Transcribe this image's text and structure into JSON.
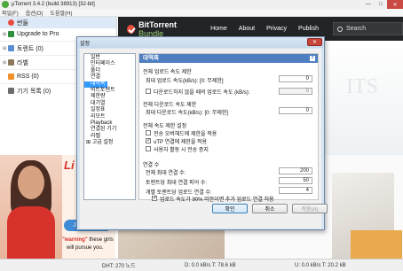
{
  "window": {
    "title": "µTorrent 3.4.2  (build 38913) [32-bit]",
    "controls": [
      "—",
      "□",
      "✕"
    ]
  },
  "menu": [
    "파일(F)",
    "옵션(O)",
    "도움말(H)"
  ],
  "sidebar": {
    "items": [
      {
        "label": "번들",
        "icon": "bundle-icon"
      },
      {
        "label": "Upgrade to Pro",
        "icon": "upgrade-icon"
      },
      {
        "label": "토렌트 (0)",
        "icon": "torrent-icon"
      },
      {
        "label": "라벨",
        "icon": "label-icon"
      },
      {
        "label": "RSS (0)",
        "icon": "rss-icon"
      },
      {
        "label": "기기 목록 (0)",
        "icon": "device-icon"
      }
    ]
  },
  "banner": {
    "brand": "BitTorrent",
    "brand_suffix": " Bundle",
    "nav": [
      "Home",
      "About",
      "Privacy",
      "Publish"
    ],
    "search_placeholder": "Search"
  },
  "ghost_text": "ITS",
  "ad_left": {
    "logo": "Li",
    "button": "Join NOW!",
    "line1_red": "\"warning\"",
    "line1_rest": " these girls",
    "line2": "will pursue you."
  },
  "dialog": {
    "title": "설정",
    "close": "✕",
    "tree": [
      {
        "label": "일반",
        "level": "child"
      },
      {
        "label": "인터페이스",
        "level": "child"
      },
      {
        "label": "폴더",
        "level": "child"
      },
      {
        "label": "연결",
        "level": "child"
      },
      {
        "label": "대역폭",
        "level": "child",
        "selected": true
      },
      {
        "label": "비트토렌트",
        "level": "child"
      },
      {
        "label": "제한량",
        "level": "child"
      },
      {
        "label": "대기열",
        "level": "child"
      },
      {
        "label": "일정표",
        "level": "child"
      },
      {
        "label": "리모트",
        "level": "child"
      },
      {
        "label": "Playback",
        "level": "child"
      },
      {
        "label": "연결된 기기",
        "level": "child"
      },
      {
        "label": "라벨",
        "level": "child"
      },
      {
        "label": "⊞ 고급 설정",
        "level": "group"
      }
    ],
    "panel": {
      "header": "대역폭",
      "help": "?",
      "sec1_title": "전체 업로드 속도 제한",
      "max_upload_label": "최대 업로드 속도(kB/s): [0: 무제한]",
      "max_upload_value": "0",
      "alt_upload_label": "다운로드하지 않을 때의 업로드 속도 (kB/s):",
      "alt_upload_value": "0",
      "sec2_title": "전체 다운로드 속도 제한",
      "max_download_label": "최대 다운로드 속도(kB/s): [0: 무제한]",
      "max_download_value": "0",
      "sec3_title": "전체 속도 제한 설정",
      "opt_overhead": "전송 오버헤드에 제한을 적용",
      "opt_utp": "uTP 연결에 제한을 적용",
      "opt_idle": "사용자 활동 시 전송 증지",
      "sec4_title": "연결 수",
      "global_conn_label": "전체 최대 연결 수:",
      "global_conn_value": "200",
      "peers_label": "토렌트당 최대 연결 피어 수:",
      "peers_value": "50",
      "slots_label": "개별 토렌트당 업로드 연결 수:",
      "slots_value": "4",
      "opt_extra_slots": "업로드 속도가 90% 미만이면 추가 업로드 연결 허용"
    },
    "buttons": {
      "ok": "확인",
      "cancel": "취소",
      "apply": "적용(A)"
    }
  },
  "status": {
    "dht": "DHT: 270 노드",
    "download": "D: 0.0 kB/s T: 78.6 kB",
    "upload": "U: 0.0 kB/s T: 20.2 kB"
  }
}
